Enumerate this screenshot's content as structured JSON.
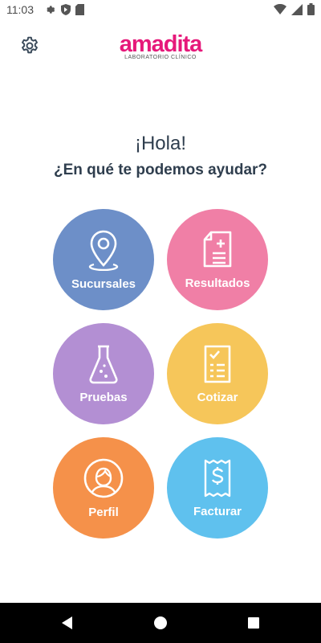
{
  "status_bar": {
    "time": "11:03",
    "icons": [
      "gear-icon",
      "play-protect-icon",
      "sd-card-icon",
      "wifi-icon",
      "signal-icon",
      "battery-icon"
    ]
  },
  "header": {
    "brand": "amadita",
    "subtitle": "LABORATORIO CLÍNICO",
    "brand_color": "#e6197a"
  },
  "greeting": {
    "hello": "¡Hola!",
    "question": "¿En qué te podemos ayudar?"
  },
  "menu": [
    {
      "label": "Sucursales",
      "icon": "location-pin-icon",
      "color": "#6d8fc8"
    },
    {
      "label": "Resultados",
      "icon": "document-plus-icon",
      "color": "#f07fa6"
    },
    {
      "label": "Pruebas",
      "icon": "flask-icon",
      "color": "#b38fd3"
    },
    {
      "label": "Cotizar",
      "icon": "checklist-icon",
      "color": "#f6c65a"
    },
    {
      "label": "Perfil",
      "icon": "user-icon",
      "color": "#f5914a"
    },
    {
      "label": "Facturar",
      "icon": "receipt-dollar-icon",
      "color": "#5fc1ee"
    }
  ],
  "nav_bar": {
    "buttons": [
      "back-icon",
      "home-icon",
      "recents-icon"
    ]
  }
}
